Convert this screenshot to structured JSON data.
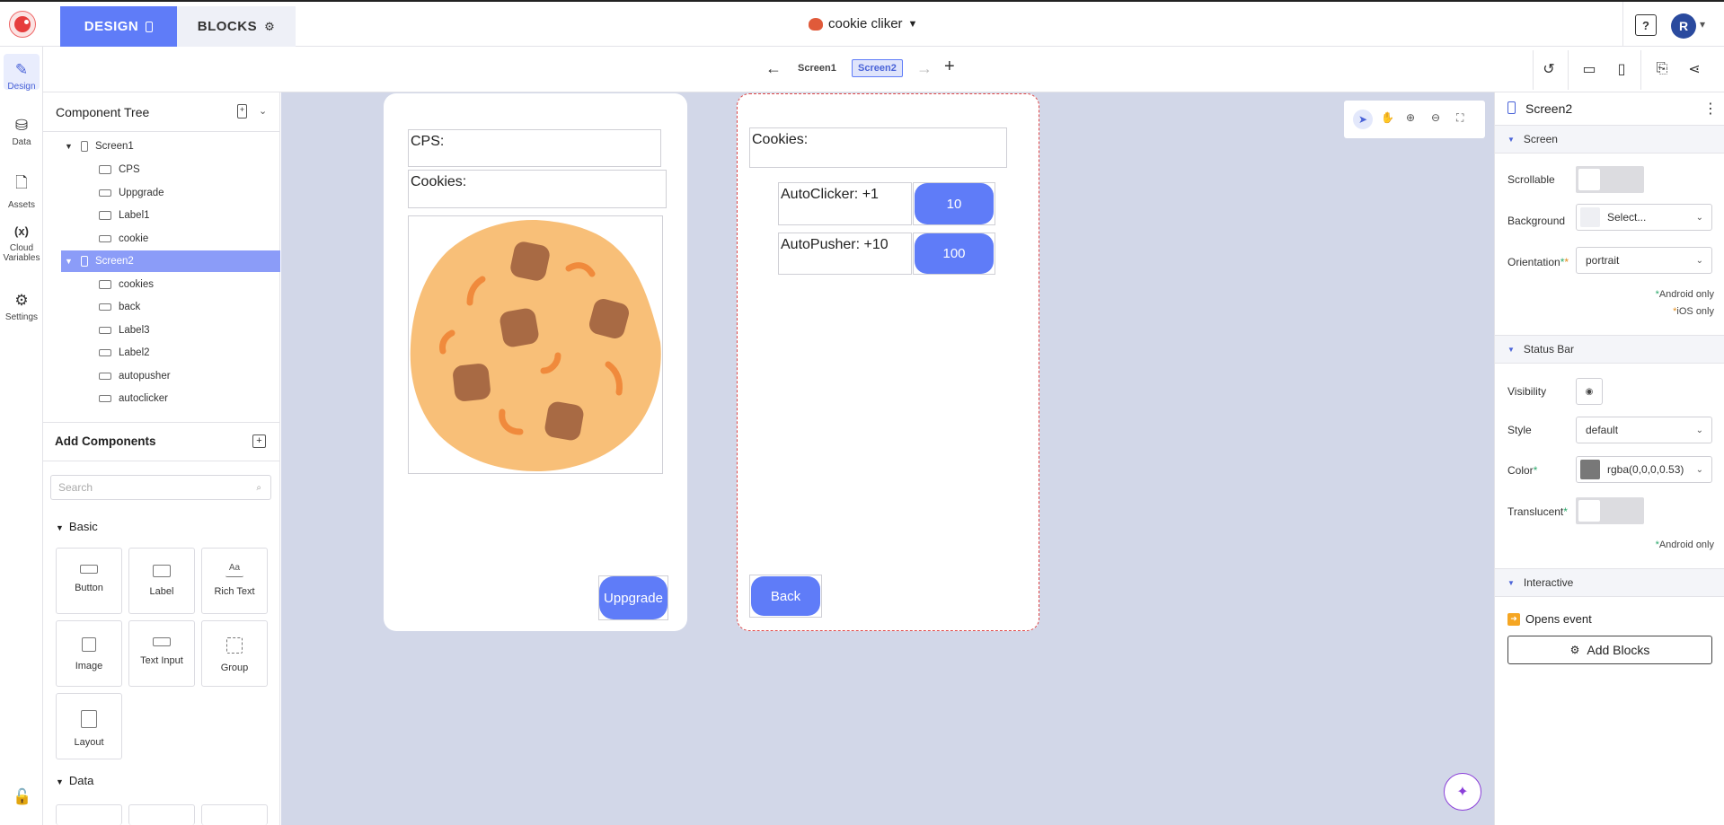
{
  "topbar": {
    "tab_design": "DESIGN",
    "tab_blocks": "BLOCKS",
    "project_name": "cookie cliker",
    "help": "?",
    "avatar_initial": "R"
  },
  "subbar": {
    "screens": [
      "Screen1",
      "Screen2"
    ],
    "active_screen": "Screen2"
  },
  "rail": {
    "items": [
      {
        "label": "Design",
        "icon": "brush-icon"
      },
      {
        "label": "Data",
        "icon": "database-icon"
      },
      {
        "label": "Assets",
        "icon": "file-icon"
      },
      {
        "label": "Cloud Variables",
        "icon": "variable-icon"
      },
      {
        "label": "Settings",
        "icon": "gear-icon"
      }
    ]
  },
  "tree": {
    "title": "Component Tree",
    "rows": [
      {
        "label": "Screen1",
        "type": "screen",
        "depth": 0
      },
      {
        "label": "CPS",
        "type": "label",
        "depth": 1
      },
      {
        "label": "Uppgrade",
        "type": "button",
        "depth": 1
      },
      {
        "label": "Label1",
        "type": "label",
        "depth": 1
      },
      {
        "label": "cookie",
        "type": "button",
        "depth": 1
      },
      {
        "label": "Screen2",
        "type": "screen",
        "depth": 0,
        "selected": true
      },
      {
        "label": "cookies",
        "type": "label",
        "depth": 1
      },
      {
        "label": "back",
        "type": "button",
        "depth": 1
      },
      {
        "label": "Label3",
        "type": "label",
        "depth": 1
      },
      {
        "label": "Label2",
        "type": "label",
        "depth": 1
      },
      {
        "label": "autopusher",
        "type": "button",
        "depth": 1
      },
      {
        "label": "autoclicker",
        "type": "button",
        "depth": 1
      }
    ]
  },
  "add_components": {
    "title": "Add Components",
    "search_placeholder": "Search",
    "section_basic": "Basic",
    "section_data": "Data",
    "tiles": [
      "Button",
      "Label",
      "Rich Text",
      "Image",
      "Text Input",
      "Group",
      "Layout"
    ]
  },
  "screen1": {
    "cps_label": "CPS:",
    "cookies_label": "Cookies:",
    "upgrade_button": "Uppgrade"
  },
  "screen2": {
    "cookies_label": "Cookies:",
    "autoclicker_label": "AutoClicker: +1",
    "autoclicker_price": "10",
    "autopusher_label": "AutoPusher:  +10",
    "autopusher_price": "100",
    "back_button": "Back"
  },
  "properties": {
    "title": "Screen2",
    "section_screen": "Screen",
    "section_status_bar": "Status Bar",
    "section_interactive": "Interactive",
    "scrollable_label": "Scrollable",
    "background_label": "Background",
    "background_value": "Select...",
    "orientation_label": "Orientation",
    "orientation_value": "portrait",
    "android_only": "Android only",
    "ios_only": "iOS only",
    "visibility_label": "Visibility",
    "style_label": "Style",
    "style_value": "default",
    "color_label": "Color",
    "color_value": "rgba(0,0,0,0.53)",
    "translucent_label": "Translucent",
    "opens_event": "Opens event",
    "add_blocks": "Add Blocks"
  },
  "colors": {
    "accent": "#5f7cf8",
    "canvas_bg": "#d2d7e8",
    "cookie_dough": "#f8bf78",
    "cookie_chip": "#a86a44",
    "cookie_crumb": "#f08a3c"
  }
}
